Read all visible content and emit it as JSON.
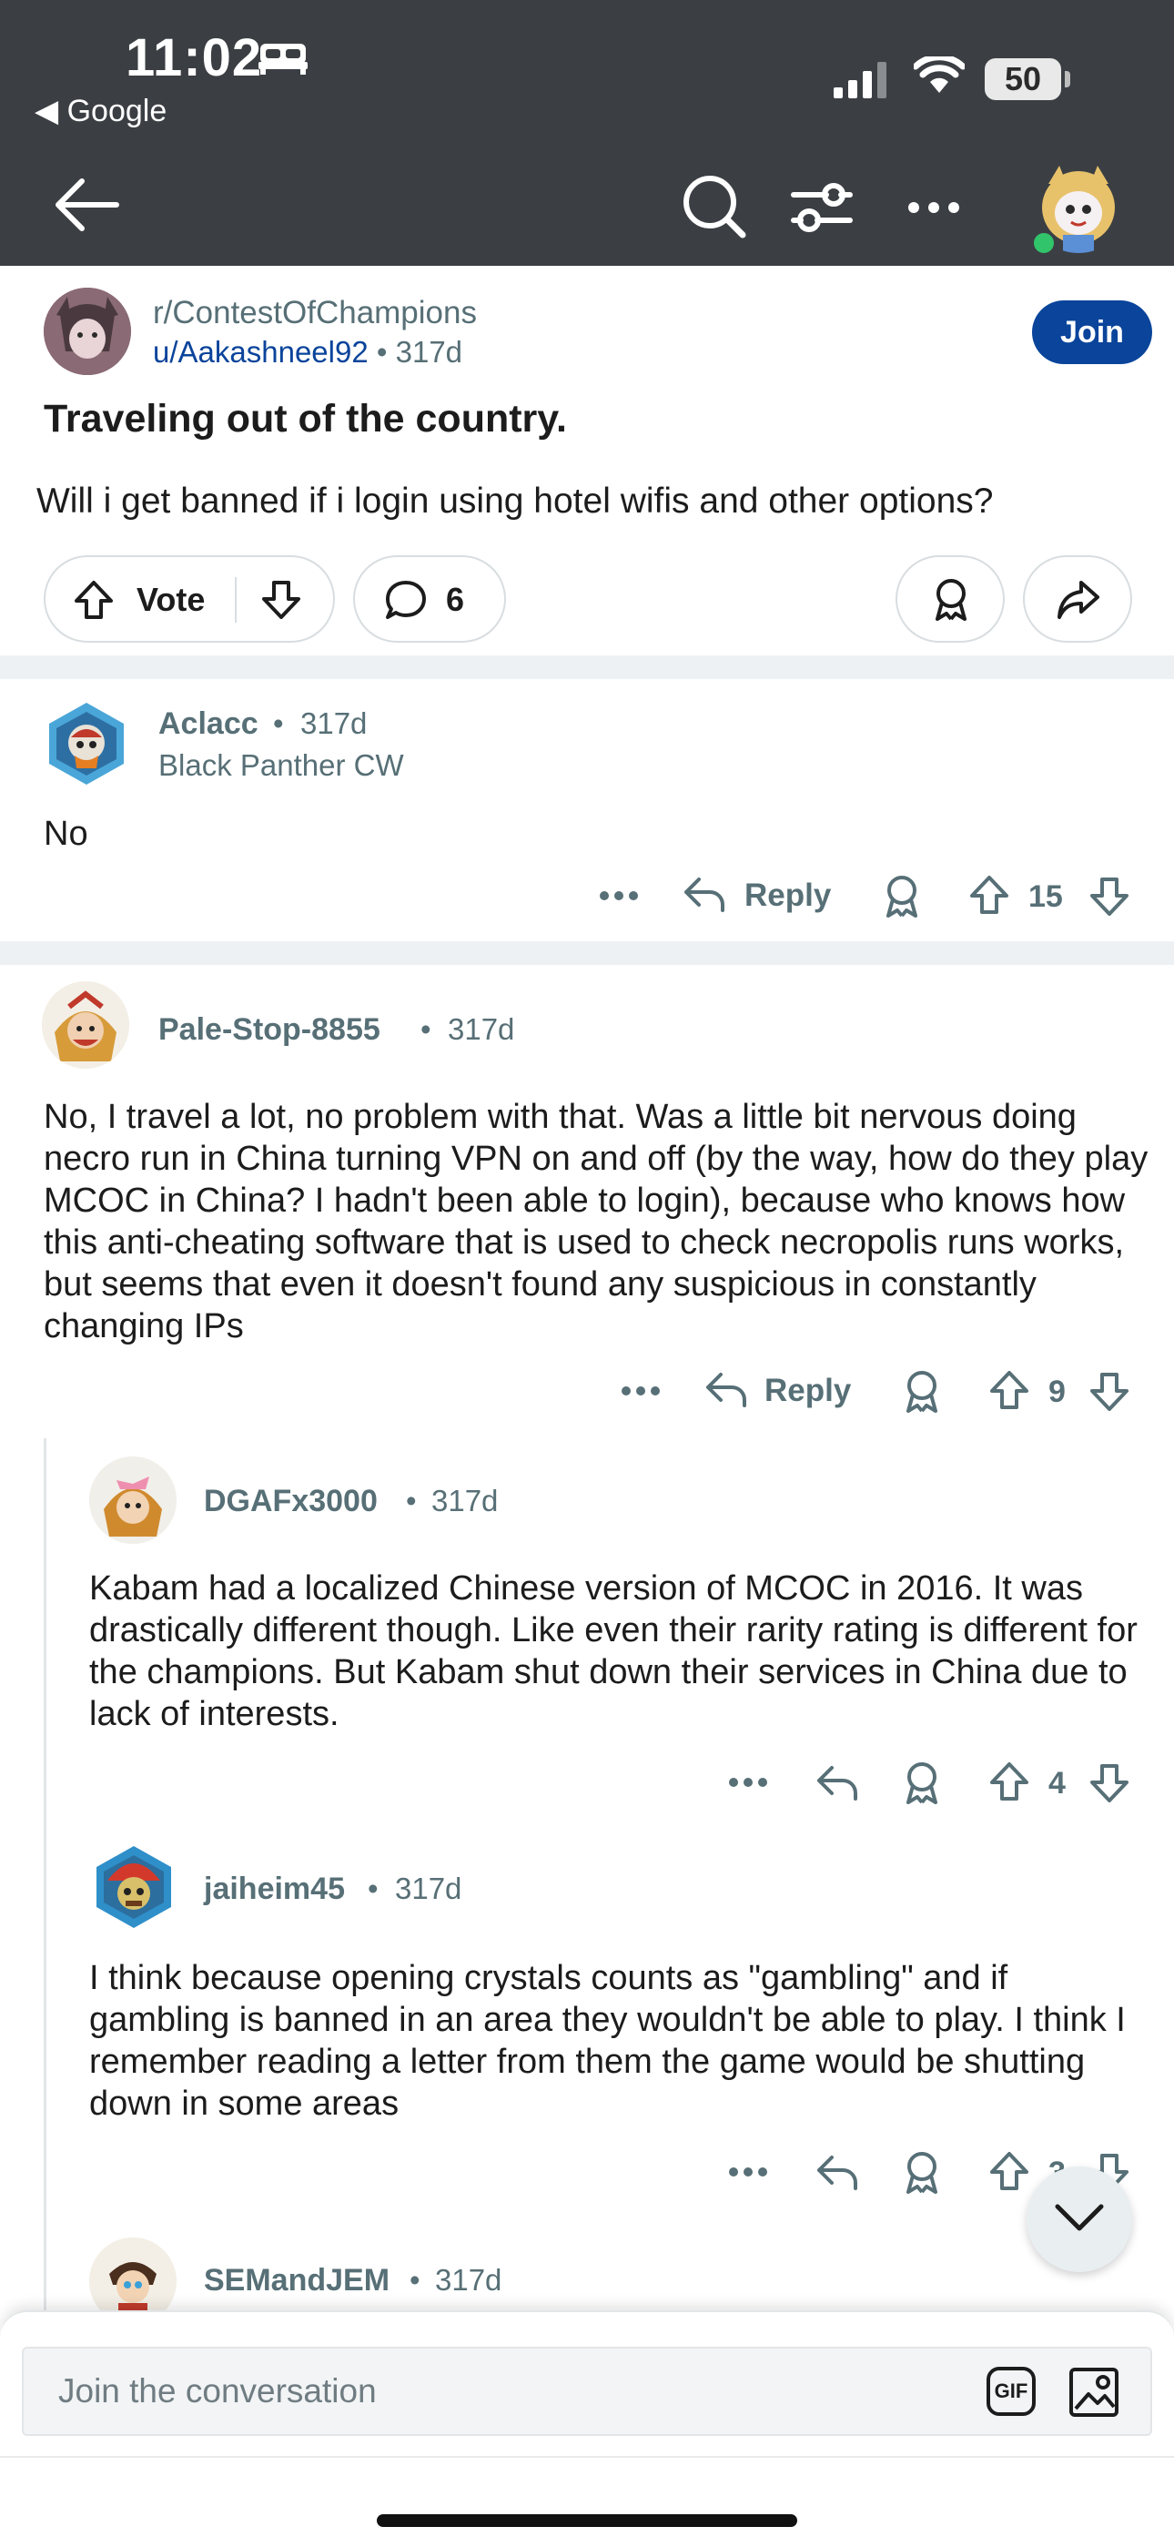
{
  "status_bar": {
    "time": "11:02",
    "back_app": "Google",
    "battery": "50"
  },
  "post": {
    "subreddit": "r/ContestOfChampions",
    "author": "u/Aakashneel92",
    "age": "317d",
    "join_label": "Join",
    "title": "Traveling out of the country.",
    "body": "Will i get banned if i login using hotel wifis and other options?",
    "vote_label": "Vote",
    "comment_count": "6"
  },
  "comments": [
    {
      "user": "Aclacc",
      "age": "317d",
      "flair": "Black Panther CW",
      "body": "No",
      "reply_label": "Reply",
      "score": "15"
    },
    {
      "user": "Pale-Stop-8855",
      "age": "317d",
      "body": "No, I travel a lot, no problem with that. Was a little bit nervous doing necro run in China turning VPN on and off (by the way, how do they play MCOC in China? I hadn't been able to login), because who knows how this anti-cheating software that is used to check necropolis runs works, but seems that even it doesn't found any suspicious in constantly changing IPs",
      "reply_label": "Reply",
      "score": "9"
    },
    {
      "user": "DGAFx3000",
      "age": "317d",
      "body": "Kabam had a localized Chinese version of MCOC in 2016. It was drastically different though. Like even their rarity rating is different for the champions. But Kabam shut down their services in China due to lack of interests.",
      "score": "4"
    },
    {
      "user": "jaiheim45",
      "age": "317d",
      "body": "I think because opening crystals counts as \"gambling\" and if gambling is banned in an area they wouldn't be able to play. I think I remember reading a letter from them the game would be shutting down in some areas",
      "score": "3"
    },
    {
      "user": "SEMandJEM",
      "age": "317d"
    }
  ],
  "composer": {
    "placeholder": "Join the conversation",
    "gif_label": "GIF"
  },
  "colors": {
    "topbar": "#3b3f43",
    "join_button": "#0a449b",
    "meta_text": "#576f76",
    "divider": "#eef1f3"
  }
}
